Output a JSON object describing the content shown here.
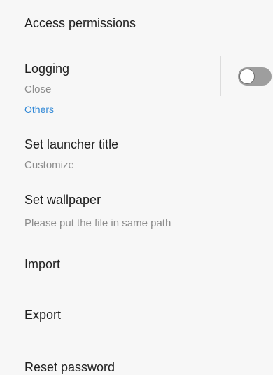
{
  "settings": {
    "access_permissions": {
      "title": "Access permissions"
    },
    "logging": {
      "title": "Logging",
      "summary": "Close",
      "toggle_on": false
    },
    "section_others": "Others",
    "launcher_title": {
      "title": "Set launcher title",
      "summary": "Customize"
    },
    "wallpaper": {
      "title": "Set wallpaper",
      "summary": "Please put the file in same path"
    },
    "import": {
      "title": "Import"
    },
    "export": {
      "title": "Export"
    },
    "reset_password": {
      "title": "Reset password"
    }
  },
  "colors": {
    "background": "#f7f7f7",
    "title_text": "#1f1f1f",
    "summary_text": "#8c8c8c",
    "category_text": "#2f87d6",
    "toggle_track_off": "#9e9e9e",
    "toggle_knob": "#ffffff"
  }
}
